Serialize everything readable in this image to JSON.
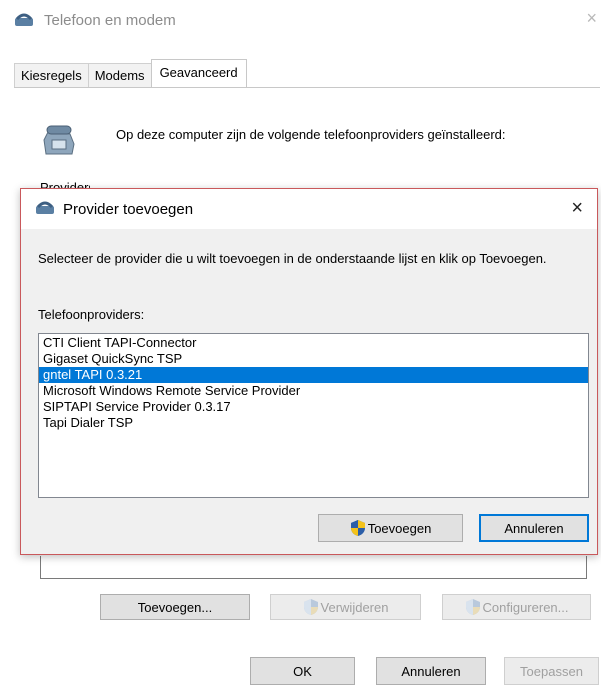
{
  "parent": {
    "title": "Telefoon en modem",
    "close_glyph": "×",
    "tabs": [
      {
        "label": "Kiesregels"
      },
      {
        "label": "Modems"
      },
      {
        "label": "Geavanceerd",
        "active": true
      }
    ],
    "info_text": "Op deze computer zijn de volgende telefoonproviders geïnstalleerd:",
    "partial_label": "Providers:",
    "buttons": {
      "add": "Toevoegen...",
      "remove": "Verwijderen",
      "configure": "Configureren..."
    },
    "footer": {
      "ok": "OK",
      "cancel": "Annuleren",
      "apply": "Toepassen"
    }
  },
  "dialog": {
    "title": "Provider toevoegen",
    "close_glyph": "×",
    "description": "Selecteer de provider die u wilt toevoegen in de onderstaande lijst en klik op Toevoegen.",
    "list_label": "Telefoonproviders:",
    "providers": [
      {
        "name": "CTI Client TAPI-Connector"
      },
      {
        "name": "Gigaset QuickSync TSP"
      },
      {
        "name": "gntel TAPI 0.3.21",
        "selected": true
      },
      {
        "name": "Microsoft Windows Remote Service Provider"
      },
      {
        "name": "SIPTAPI Service Provider 0.3.17"
      },
      {
        "name": "Tapi Dialer TSP"
      }
    ],
    "buttons": {
      "add": "Toevoegen",
      "cancel": "Annuleren"
    }
  },
  "colors": {
    "selection": "#0078d7",
    "dialog_border": "#c9585b",
    "dialog_bg": "#f0f0f0"
  },
  "icons": [
    "phone-icon",
    "shield-icon",
    "close-icon"
  ]
}
